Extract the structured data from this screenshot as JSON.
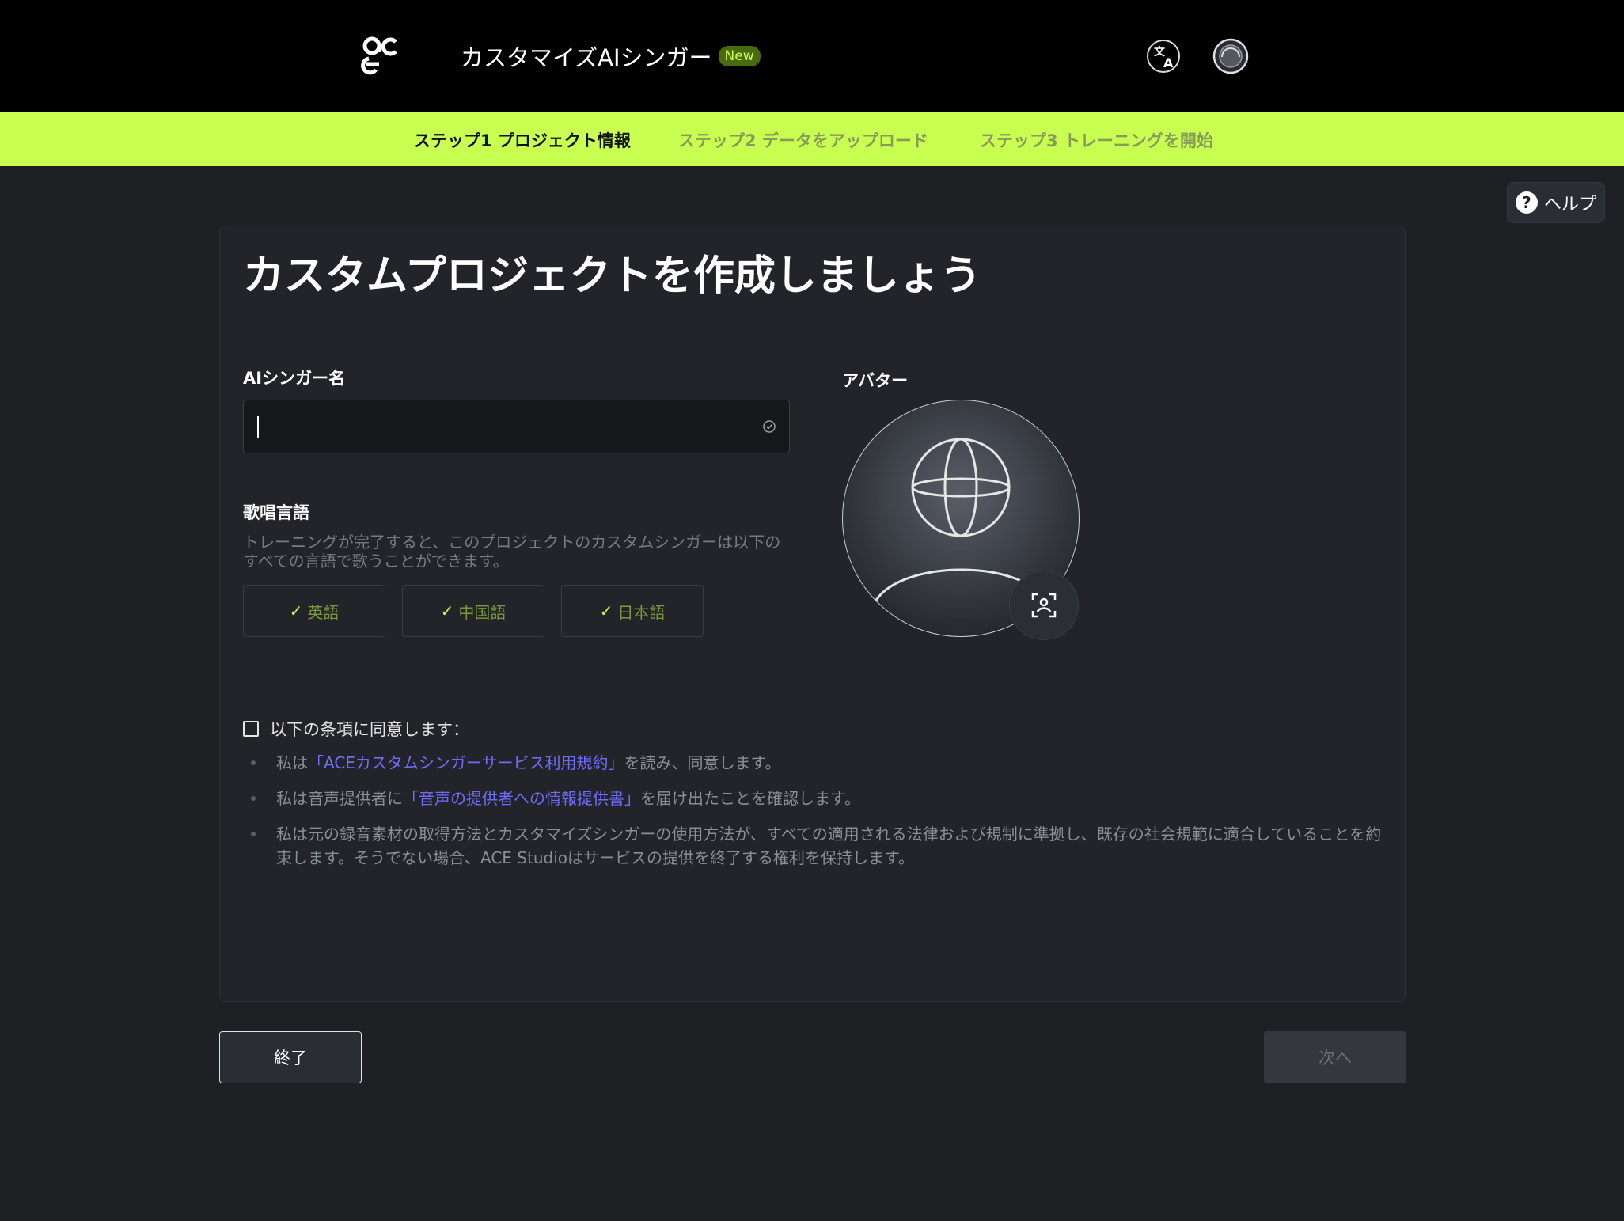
{
  "header": {
    "app_title": "カスタマイズAIシンガー",
    "new_badge": "New"
  },
  "steps": [
    {
      "label": "ステップ1 プロジェクト情報",
      "active": true
    },
    {
      "label": "ステップ2 データをアップロード",
      "active": false
    },
    {
      "label": "ステップ3 トレーニングを開始",
      "active": false
    }
  ],
  "help": {
    "label": "ヘルプ"
  },
  "card": {
    "title": "カスタムプロジェクトを作成しましょう",
    "singer_name_label": "AIシンガー名",
    "singer_name_value": "",
    "avatar_label": "アバター",
    "language_label": "歌唱言語",
    "language_desc": "トレーニングが完了すると、このプロジェクトのカスタムシンガーは以下のすべての言語で歌うことができます。",
    "languages": [
      "英語",
      "中国語",
      "日本語"
    ],
    "agree_label": "以下の条項に同意します：",
    "terms": [
      {
        "pre": "私は",
        "link": "「ACEカスタムシンガーサービス利用規約」",
        "post": "を読み、同意します。"
      },
      {
        "pre": "私は音声提供者に",
        "link": "「音声の提供者への情報提供書」",
        "post": "を届け出たことを確認します。"
      },
      {
        "pre": "私は元の録音素材の取得方法とカスタマイズシンガーの使用方法が、すべての適用される法律および規制に準拠し、既存の社会規範に適合していることを約束します。そうでない場合、ACE Studioはサービスの提供を終了する権利を保持します。",
        "link": "",
        "post": ""
      }
    ]
  },
  "footer": {
    "exit_label": "終了",
    "next_label": "次へ"
  },
  "colors": {
    "accent": "#c8ff50",
    "background": "#1e2024",
    "link": "#6f6dff"
  }
}
